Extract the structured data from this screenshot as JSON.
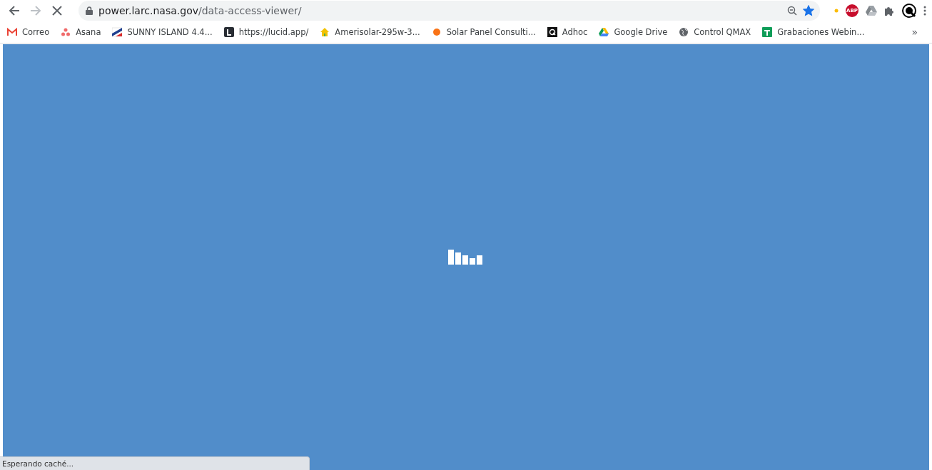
{
  "toolbar": {
    "url_domain": "power.larc.nasa.gov",
    "url_path": "/data-access-viewer/",
    "bookmarked": true,
    "extension_badge": "ABP"
  },
  "bookmarks": [
    {
      "label": "Correo",
      "kind": "mail"
    },
    {
      "label": "Asana",
      "kind": "dots"
    },
    {
      "label": "SUNNY ISLAND 4.4...",
      "kind": "flag"
    },
    {
      "label": "https://lucid.app/",
      "kind": "lucid"
    },
    {
      "label": "Amerisolar-295w-3...",
      "kind": "house"
    },
    {
      "label": "Solar Panel Consulti...",
      "kind": "dot"
    },
    {
      "label": "Adhoc",
      "kind": "q"
    },
    {
      "label": "Google Drive",
      "kind": "drive"
    },
    {
      "label": "Control QMAX",
      "kind": "globe"
    },
    {
      "label": "Grabaciones Webin...",
      "kind": "sheet"
    }
  ],
  "more_bookmarks": "»",
  "status_bar": {
    "text": "Esperando caché..."
  }
}
